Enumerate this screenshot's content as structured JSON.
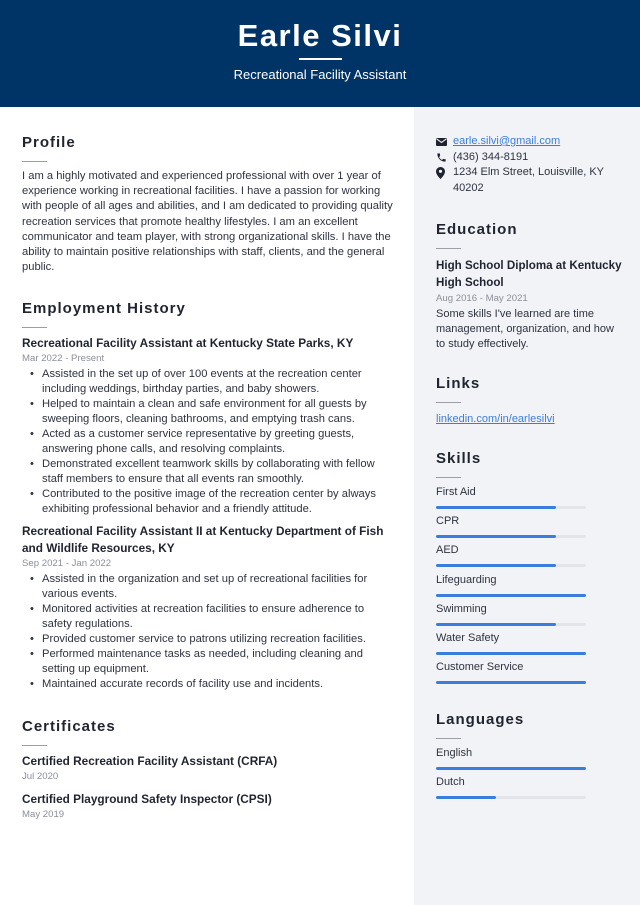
{
  "header": {
    "name": "Earle Silvi",
    "title": "Recreational Facility Assistant"
  },
  "profile": {
    "heading": "Profile",
    "text": "I am a highly motivated and experienced professional with over 1 year of experience working in recreational facilities. I have a passion for working with people of all ages and abilities, and I am dedicated to providing quality recreation services that promote healthy lifestyles. I am an excellent communicator and team player, with strong organizational skills. I have the ability to maintain positive relationships with staff, clients, and the general public."
  },
  "employment": {
    "heading": "Employment History",
    "jobs": [
      {
        "title": "Recreational Facility Assistant at Kentucky State Parks, KY",
        "dates": "Mar 2022 - Present",
        "bullets": [
          "Assisted in the set up of over 100 events at the recreation center including weddings, birthday parties, and baby showers.",
          "Helped to maintain a clean and safe environment for all guests by sweeping floors, cleaning bathrooms, and emptying trash cans.",
          "Acted as a customer service representative by greeting guests, answering phone calls, and resolving complaints.",
          "Demonstrated excellent teamwork skills by collaborating with fellow staff members to ensure that all events ran smoothly.",
          "Contributed to the positive image of the recreation center by always exhibiting professional behavior and a friendly attitude."
        ]
      },
      {
        "title": "Recreational Facility Assistant II at Kentucky Department of Fish and Wildlife Resources, KY",
        "dates": "Sep 2021 - Jan 2022",
        "bullets": [
          "Assisted in the organization and set up of recreational facilities for various events.",
          "Monitored activities at recreation facilities to ensure adherence to safety regulations.",
          "Provided customer service to patrons utilizing recreation facilities.",
          "Performed maintenance tasks as needed, including cleaning and setting up equipment.",
          "Maintained accurate records of facility use and incidents."
        ]
      }
    ]
  },
  "certificates": {
    "heading": "Certificates",
    "items": [
      {
        "name": "Certified Recreation Facility Assistant (CRFA)",
        "date": "Jul 2020"
      },
      {
        "name": "Certified Playground Safety Inspector (CPSI)",
        "date": "May 2019"
      }
    ]
  },
  "contact": {
    "email": "earle.silvi@gmail.com",
    "phone": "(436) 344-8191",
    "address": "1234 Elm Street, Louisville, KY 40202",
    "icons": {
      "email": "envelope-icon",
      "phone": "phone-icon",
      "address": "map-pin-icon"
    }
  },
  "education": {
    "heading": "Education",
    "degree": "High School Diploma at Kentucky High School",
    "dates": "Aug 2016 - May 2021",
    "description": "Some skills I've learned are time management, organization, and how to study effectively."
  },
  "links": {
    "heading": "Links",
    "items": [
      "linkedin.com/in/earlesilvi"
    ]
  },
  "skills": {
    "heading": "Skills",
    "items": [
      {
        "label": "First Aid",
        "level": 0.8
      },
      {
        "label": "CPR",
        "level": 0.8
      },
      {
        "label": "AED",
        "level": 0.8
      },
      {
        "label": "Lifeguarding",
        "level": 1.0
      },
      {
        "label": "Swimming",
        "level": 0.8
      },
      {
        "label": "Water Safety",
        "level": 1.0
      },
      {
        "label": "Customer Service",
        "level": 1.0
      }
    ]
  },
  "languages": {
    "heading": "Languages",
    "items": [
      {
        "label": "English",
        "level": 1.0
      },
      {
        "label": "Dutch",
        "level": 0.4
      }
    ]
  },
  "colors": {
    "header_bg": "#003366",
    "accent": "#3b7ddd",
    "sidebar_bg": "#f2f3f6"
  }
}
